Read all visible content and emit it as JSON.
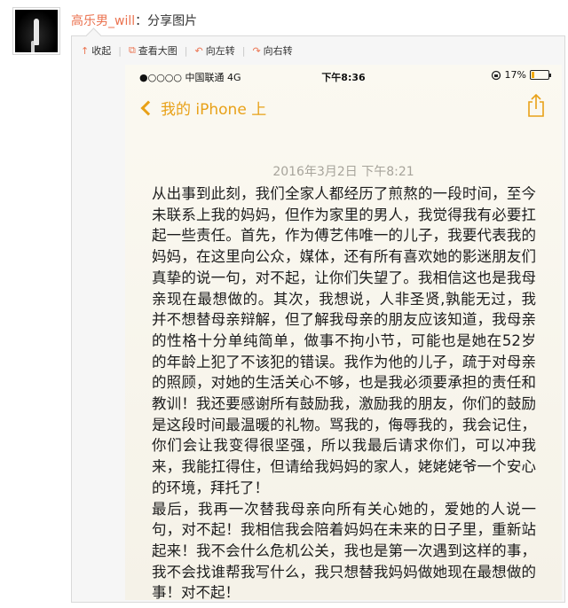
{
  "post": {
    "username": "高乐男_will",
    "action": "：分享图片"
  },
  "toolbar": {
    "collapse": "收起",
    "view_large": "查看大图",
    "rotate_left": "向左转",
    "rotate_right": "向右转"
  },
  "phone": {
    "carrier": "●○○○○ 中国联通  4G",
    "time": "下午8:36",
    "battery": "17%",
    "battery_level": 0.17,
    "accent_color": "#e8a118",
    "back_label": "我的 iPhone 上",
    "note_date": "2016年3月2日  下午8:21",
    "note_body": "从出事到此刻，我们全家人都经历了煎熬的一段时间，至今未联系上我的妈妈，但作为家里的男人，我觉得我有必要扛起一些责任。首先，作为傅艺伟唯一的儿子，我要代表我的妈妈，在这里向公众，媒体，还有所有喜欢她的影迷朋友们真挚的说一句，对不起，让你们失望了。我相信这也是我母亲现在最想做的。其次，我想说，人非圣贤,孰能无过，我并不想替母亲辩解，但了解我母亲的朋友应该知道，我母亲的性格十分单纯简单，做事不拘小节，可能也是她在52岁的年龄上犯了不该犯的错误。我作为他的儿子，疏于对母亲的照顾，对她的生活关心不够，也是我必须要承担的责任和教训！我还要感谢所有鼓励我，激励我的朋友，你们的鼓励是这段时间最温暖的礼物。骂我的，侮辱我的，我会记住，你们会让我变得很坚强，所以我最后请求你们，可以冲我来，我能扛得住，但请给我妈妈的家人，姥姥姥爷一个安心的环境，拜托了！\n最后，我再一次替我母亲向所有关心她的，爱她的人说一句，对不起！我相信我会陪着妈妈在未来的日子里，重新站起来！我不会什么危机公关，我也是第一次遇到这样的事，我不会找谁帮我写什么，我只想替我妈妈做她现在最想做的事！对不起！"
  }
}
